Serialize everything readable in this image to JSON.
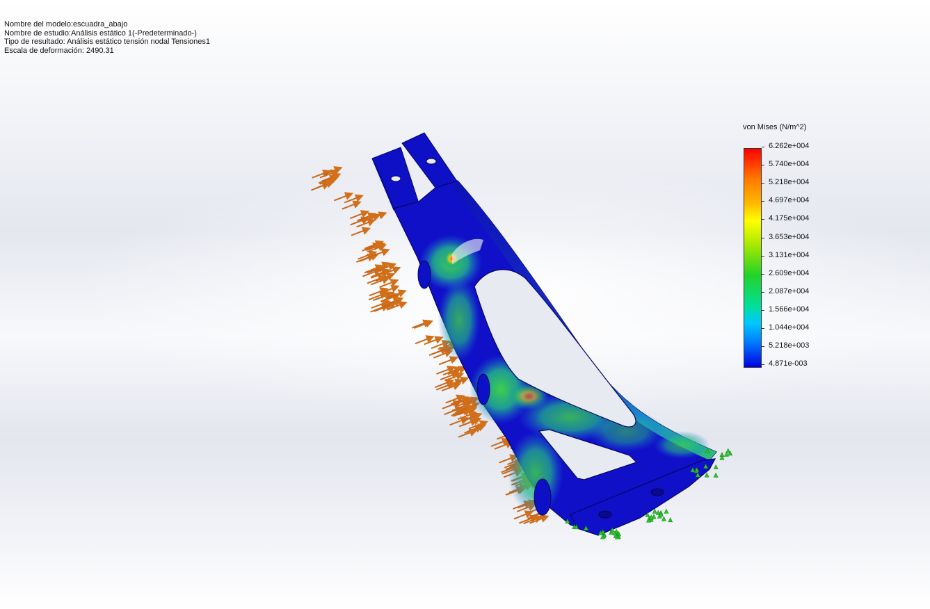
{
  "info": {
    "model_name": "Nombre del modelo:escuadra_abajo",
    "study_name": "Nombre de estudio:Análisis estático 1(-Predeterminado-)",
    "result_type": "Tipo de resultado: Análisis estático tensión nodal Tensiones1",
    "deformation_scale": "Escala de deformación: 2490.31"
  },
  "legend": {
    "title": "von Mises (N/m^2)",
    "labels": [
      "6.262e+004",
      "5.740e+004",
      "5.218e+004",
      "4.697e+004",
      "4.175e+004",
      "3.653e+004",
      "3.131e+004",
      "2.609e+004",
      "2.087e+004",
      "1.566e+004",
      "1.044e+004",
      "5.218e+003",
      "4.871e-003"
    ],
    "colors": {
      "max": "#ff0000",
      "mid": "#22d22a",
      "min": "#0000e0"
    }
  },
  "viewport": {
    "part_colors": {
      "base": "#1010c8",
      "low": "#1a6fd8",
      "mid": "#22c070",
      "high": "#d8c020",
      "peak": "#ff5020"
    },
    "load_arrow_color": "#d2701a",
    "fixture_color": "#28c828"
  }
}
